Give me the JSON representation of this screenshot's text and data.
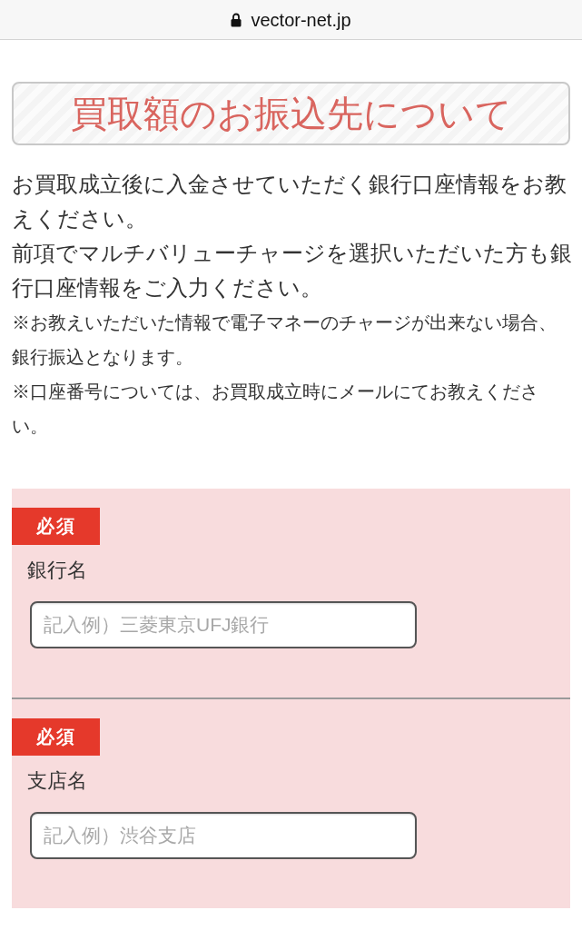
{
  "address_bar": {
    "domain": "vector-net.jp"
  },
  "heading": "買取額のお振込先について",
  "intro": [
    {
      "kind": "main",
      "text": "お買取成立後に入金させていただく銀行口座情報をお教えください。"
    },
    {
      "kind": "main",
      "text": "前項でマルチバリューチャージを選択いただいた方も銀行口座情報をご入力ください。"
    },
    {
      "kind": "note",
      "text": "※お教えいただいた情報で電子マネーのチャージが出来ない場合、銀行振込となります。"
    },
    {
      "kind": "note",
      "text": "※口座番号については、お買取成立時にメールにてお教えください。"
    }
  ],
  "fields": [
    {
      "badge": "必須",
      "label": "銀行名",
      "placeholder": "記入例）三菱東京UFJ銀行"
    },
    {
      "badge": "必須",
      "label": "支店名",
      "placeholder": "記入例）渋谷支店"
    }
  ]
}
